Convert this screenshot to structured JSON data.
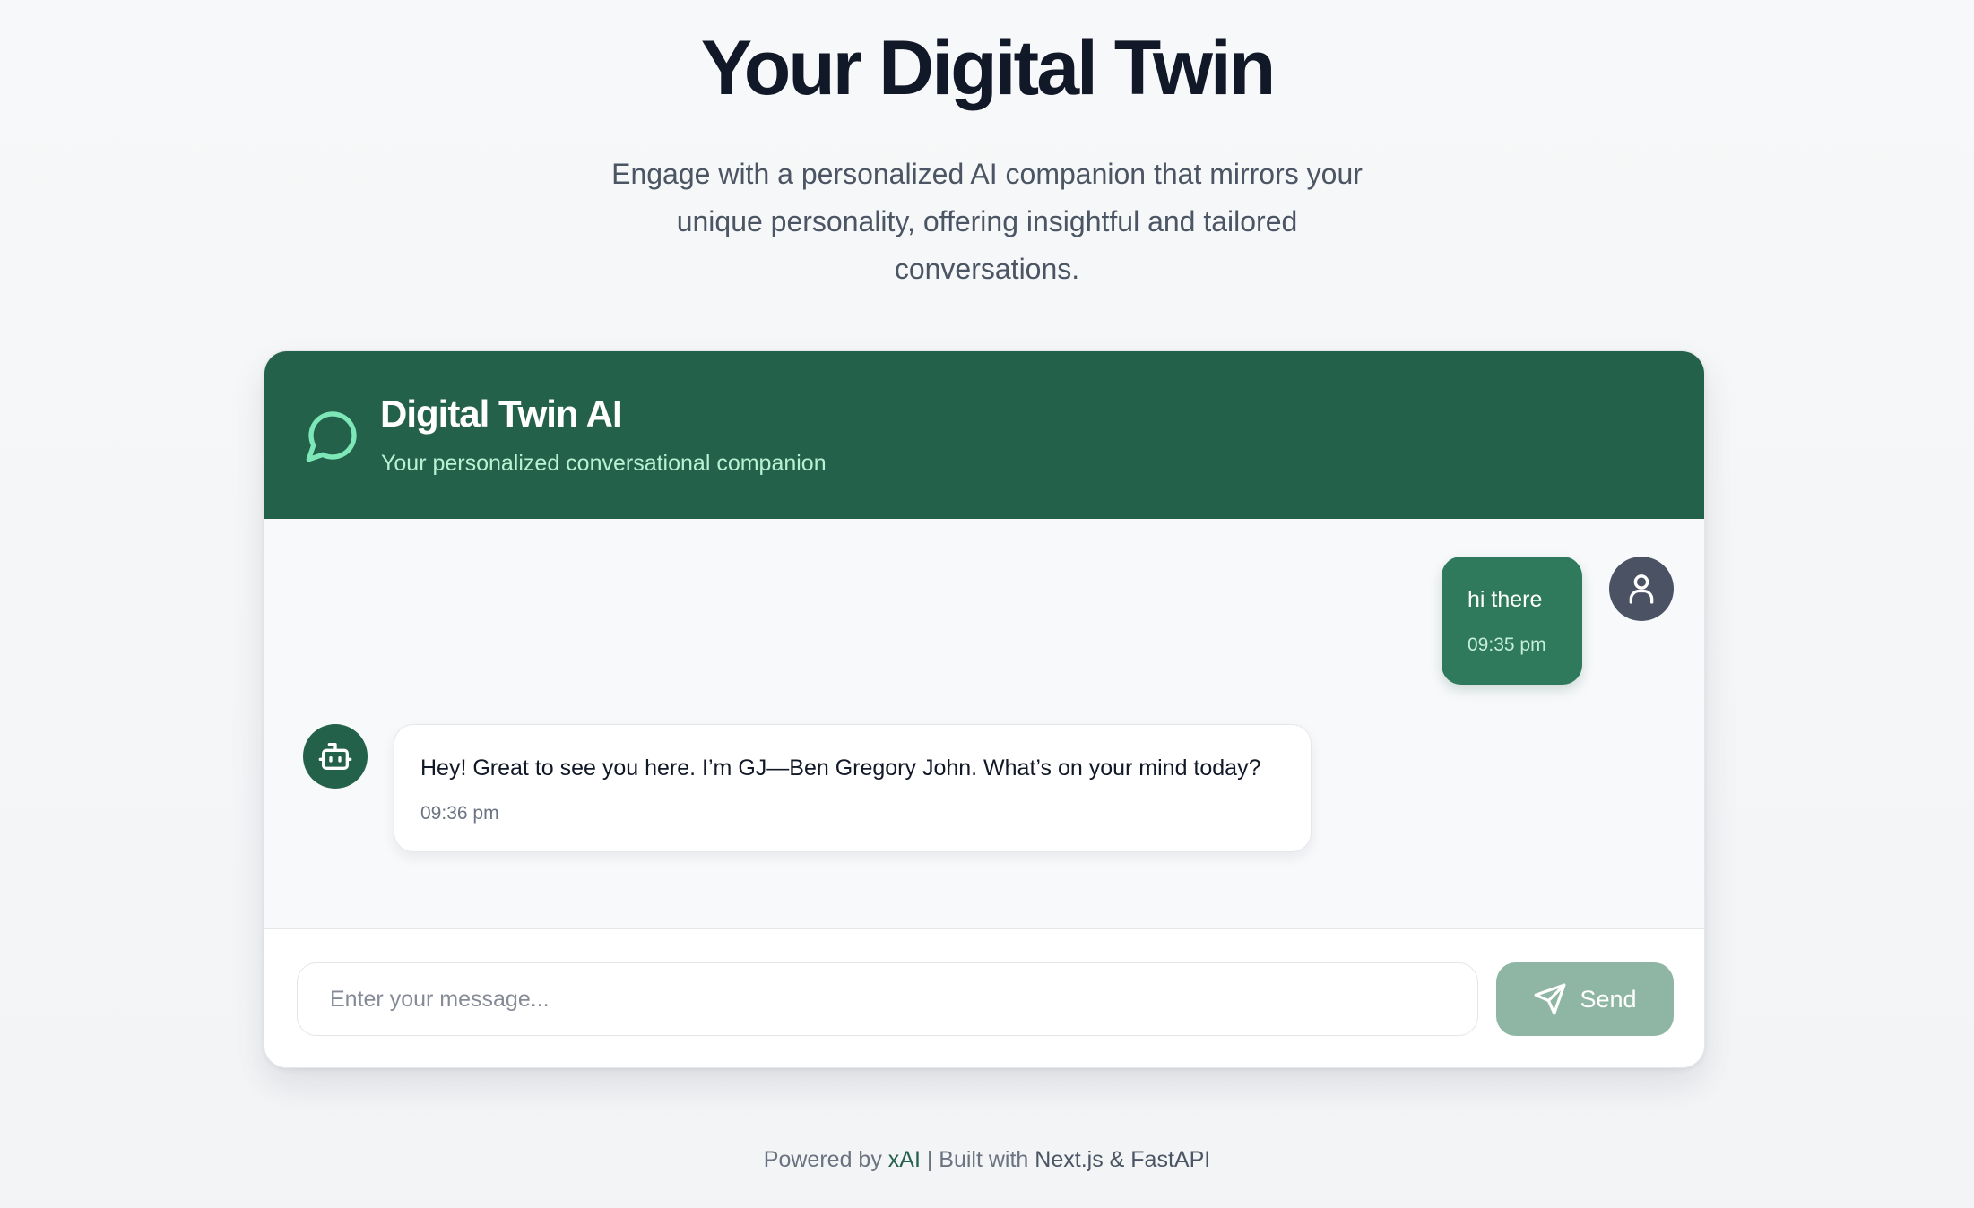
{
  "hero": {
    "title": "Your Digital Twin",
    "subtitle": "Engage with a personalized AI companion that mirrors your unique personality, offering insightful and tailored conversations."
  },
  "chat": {
    "title": "Digital Twin AI",
    "tagline": "Your personalized conversational companion",
    "icon": "message-circle-icon",
    "messages": [
      {
        "role": "user",
        "text": "hi there",
        "time": "09:35 pm",
        "avatar_icon": "user-icon"
      },
      {
        "role": "assistant",
        "text": "Hey! Great to see you here. I’m GJ—Ben Gregory John. What’s on your mind today?",
        "time": "09:36 pm",
        "avatar_icon": "bot-icon"
      }
    ],
    "input": {
      "value": "",
      "placeholder": "Enter your message..."
    },
    "send_label": "Send",
    "send_icon": "send-icon"
  },
  "footer": {
    "powered_prefix": "Powered by",
    "powered_by": "xAI",
    "separator": "| Built with",
    "tech": "Next.js & FastAPI"
  },
  "colors": {
    "header_bg": "#24614a",
    "user_bubble": "#2f7a5c",
    "send_button": "#8fb6a5",
    "user_avatar": "#4a5264",
    "link": "#24614a"
  }
}
